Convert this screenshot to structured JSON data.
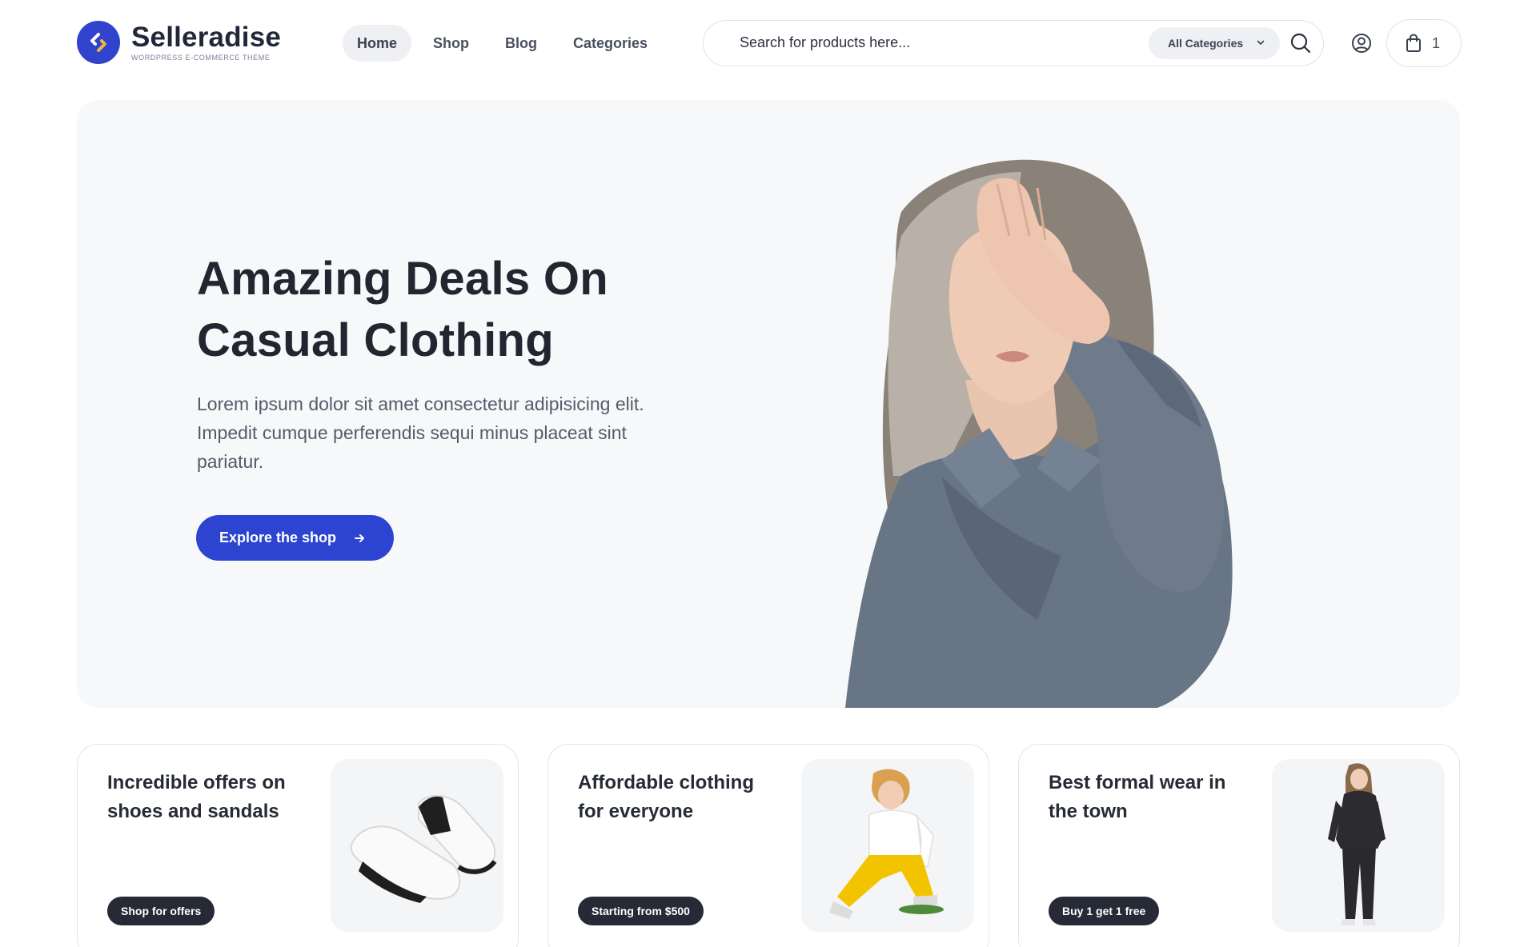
{
  "brand": {
    "name": "Selleradise",
    "tagline": "WORDPRESS E-COMMERCE THEME",
    "accent": "#2f43cc",
    "logo_accent": "#f2b33d"
  },
  "nav": {
    "items": [
      {
        "label": "Home",
        "active": true
      },
      {
        "label": "Shop",
        "active": false
      },
      {
        "label": "Blog",
        "active": false
      },
      {
        "label": "Categories",
        "active": false
      }
    ]
  },
  "search": {
    "placeholder": "Search for products here...",
    "category_selected": "All Categories",
    "search_icon": "search-icon"
  },
  "account": {
    "icon": "user-circle-icon"
  },
  "cart": {
    "icon": "shopping-bag-icon",
    "count": "1"
  },
  "hero": {
    "title": "Amazing Deals On Casual Clothing",
    "text": "Lorem ipsum dolor sit amet consectetur adipisicing elit. Impedit cumque perferendis sequi minus placeat sint pariatur.",
    "cta_label": "Explore the shop",
    "cta_icon": "arrow-right-icon",
    "background": "#f7f8fa",
    "cta_color": "#2c44d0"
  },
  "cards": [
    {
      "title": "Incredible offers on shoes and sandals",
      "pill": "Shop for offers",
      "image": "sneakers-image"
    },
    {
      "title": "Affordable clothing for everyone",
      "pill": "Starting from $500",
      "image": "boy-sitting-image"
    },
    {
      "title": "Best formal wear in the town",
      "pill": "Buy 1 get 1 free",
      "image": "woman-standing-image"
    }
  ]
}
